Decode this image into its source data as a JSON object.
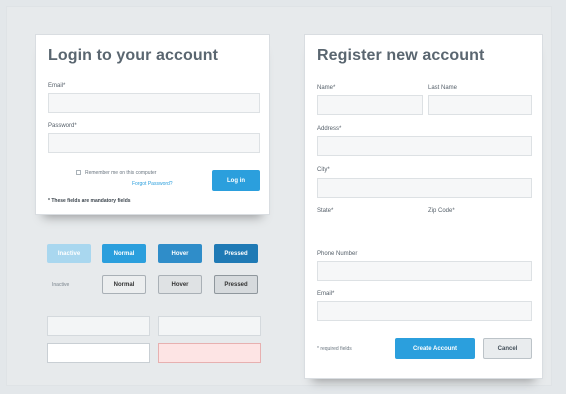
{
  "login": {
    "title": "Login to your account",
    "email_label": "Email*",
    "email_value": "",
    "password_label": "Password*",
    "password_value": "",
    "remember_text": "Remember me on this computer",
    "forgot_link": "Forgot Password?",
    "login_button": "Log in",
    "required_note": "* These fields are mandatory fields"
  },
  "register": {
    "title": "Register new account",
    "name_label": "Name*",
    "last_name_label": "Last Name",
    "address_label": "Address*",
    "city_label": "City*",
    "state_label": "State*",
    "zip_label": "Zip Code*",
    "phone_label": "Phone Number",
    "email_label": "Email*",
    "required_note": "* required fields",
    "create_button": "Create Account",
    "cancel_button": "Cancel"
  },
  "button_styles": {
    "filled": [
      "Inactive",
      "Normal",
      "Hover",
      "Pressed"
    ],
    "outline_label": "Inactive",
    "outline": [
      "Normal",
      "Hover",
      "Pressed"
    ]
  },
  "colors": {
    "accent": "#2b9fdd",
    "accent_inactive": "#a9d7ef",
    "accent_hover": "#2f8dc9",
    "accent_pressed": "#1f7ab5",
    "error_field": "#fde4e4"
  }
}
